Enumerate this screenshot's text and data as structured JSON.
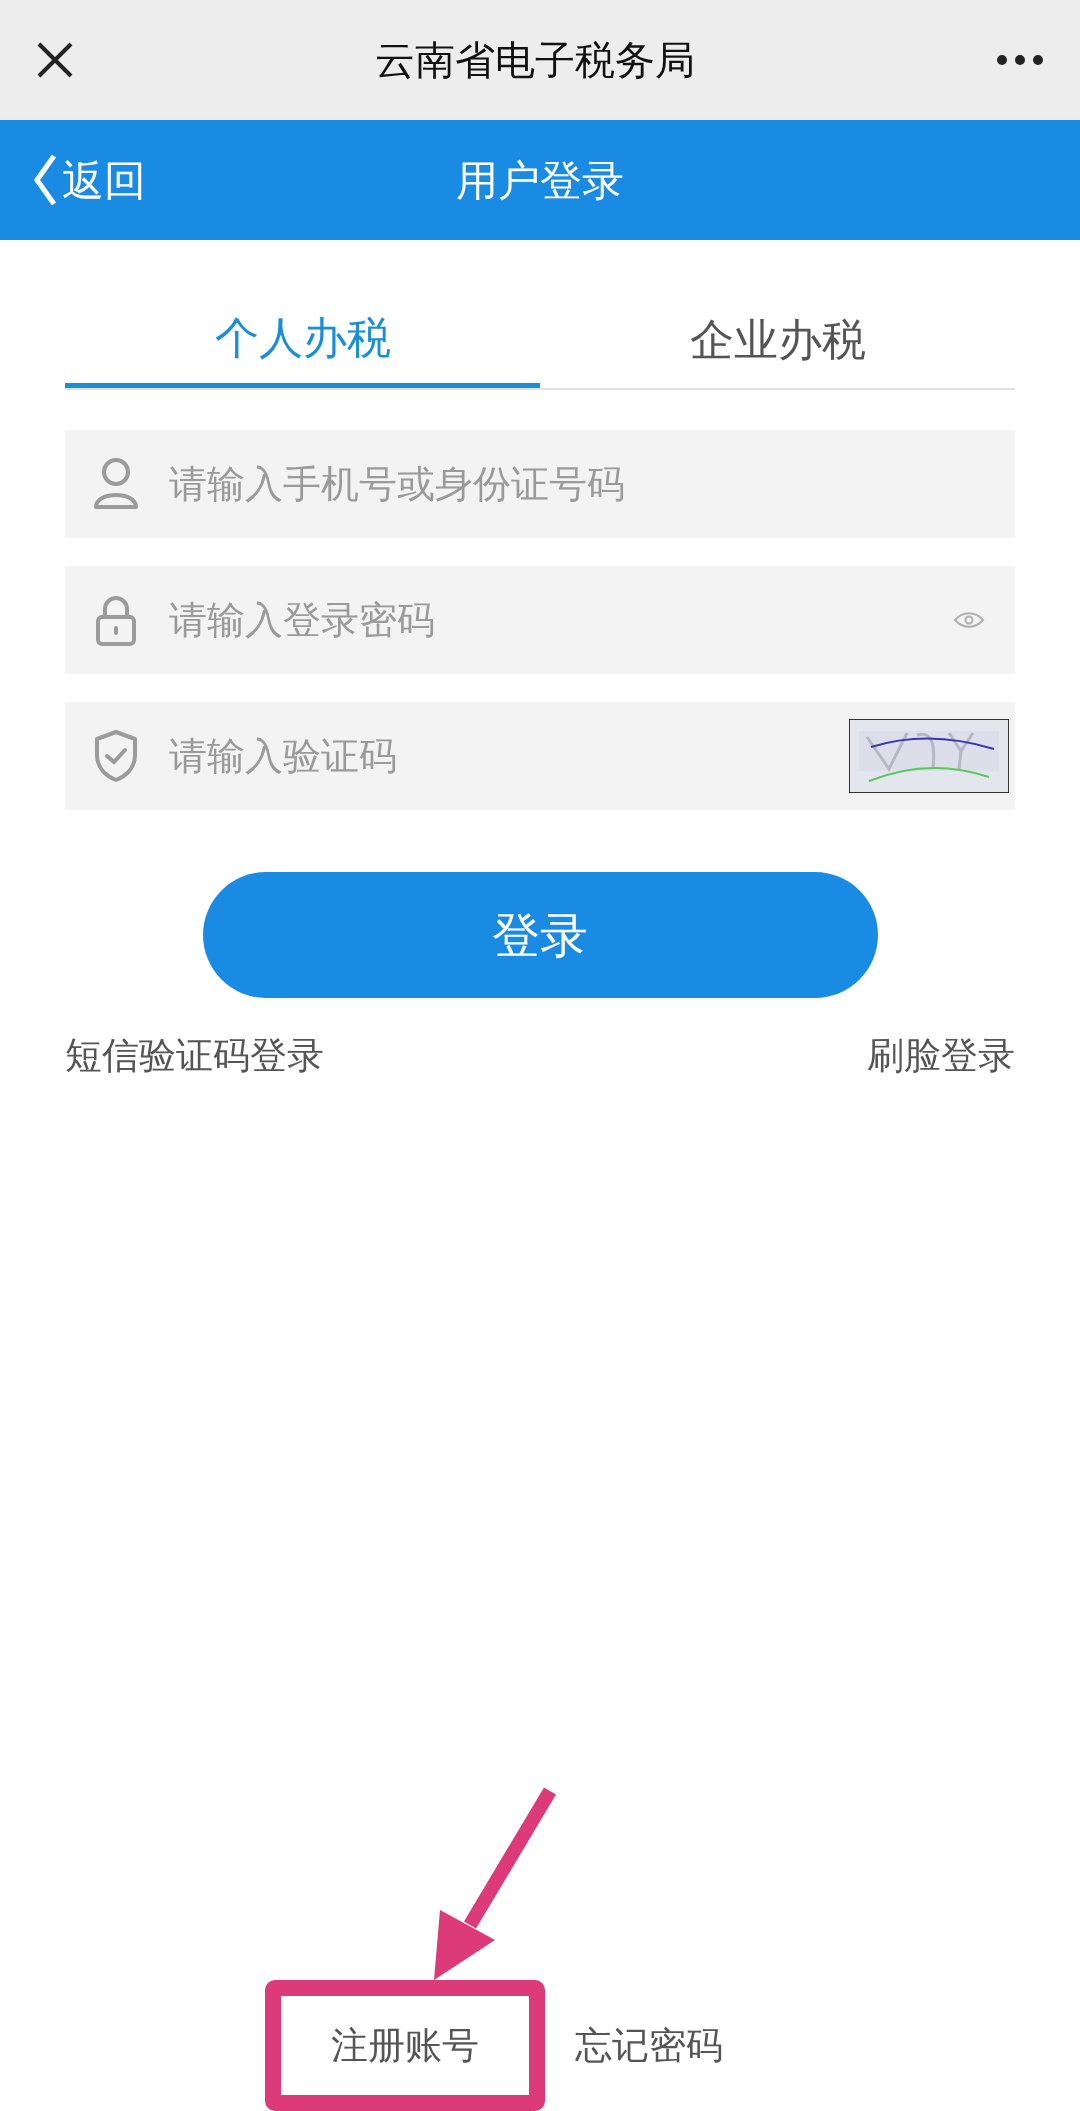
{
  "window": {
    "title": "云南省电子税务局"
  },
  "nav": {
    "back": "返回",
    "title": "用户登录"
  },
  "tabs": [
    {
      "label": "个人办税",
      "selected": true
    },
    {
      "label": "企业办税",
      "selected": false
    }
  ],
  "fields": [
    {
      "kind": "user",
      "placeholder": "请输入手机号或身份证号码"
    },
    {
      "kind": "password",
      "placeholder": "请输入登录密码"
    },
    {
      "kind": "captcha",
      "placeholder": "请输入验证码"
    }
  ],
  "login_button": "登录",
  "alt_links": [
    "短信验证码登录",
    "刷脸登录"
  ],
  "footer_links": [
    {
      "label": "注册账号",
      "highlighted": true
    },
    {
      "label": "忘记密码",
      "highlighted": false
    }
  ]
}
